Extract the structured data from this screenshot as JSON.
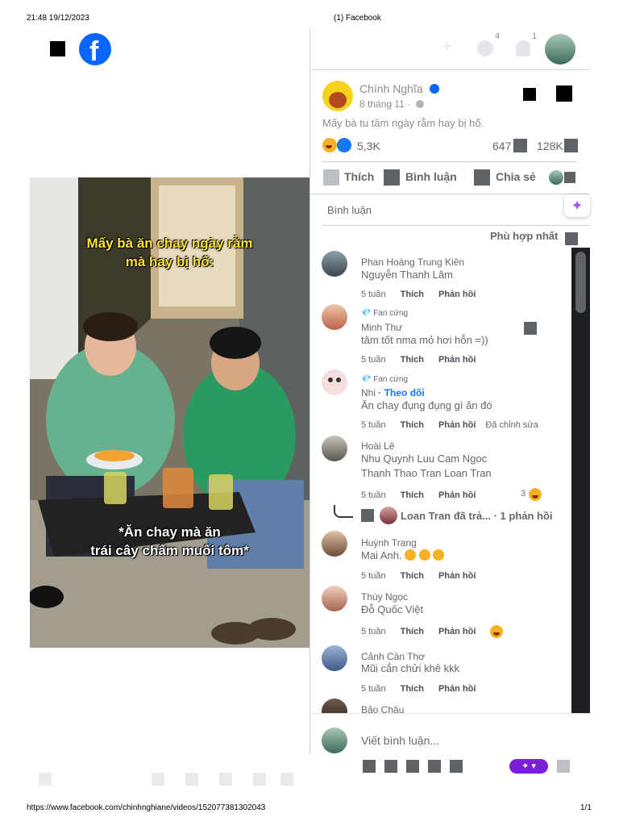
{
  "print": {
    "datetime": "21:48 19/12/2023",
    "tab_title": "(1) Facebook",
    "url": "https://www.facebook.com/chinhnghiane/videos/152077381302043",
    "page": "1/1"
  },
  "topbar": {
    "messenger_count": "4",
    "notif_count": "1"
  },
  "post": {
    "author": "Chính Nghĩa",
    "date": "8 tháng 11 ·",
    "caption": "Mấy bà tu tâm ngày rằm hay bị hố.",
    "reactions": "5,3K",
    "comments_count": "647",
    "shares_count": "128K"
  },
  "actions": {
    "like": "Thích",
    "comment": "Bình luận",
    "share": "Chia sẻ"
  },
  "comments_header": {
    "title": "Bình luận",
    "sort": "Phù hợp nhất"
  },
  "video": {
    "caption_top_line1": "Mấy bà ăn chay ngày rằm",
    "caption_top_line2": "mà hay bị hố:",
    "caption_bottom_line1": "*Ăn chay mà ăn",
    "caption_bottom_line2": "trái cây chấm muối tôm*"
  },
  "comments": [
    {
      "name": "Phan Hoàng Trung Kiên",
      "text": "Nguyễn Thanh Lâm",
      "time": "5 tuần",
      "like": "Thích",
      "reply": "Phản hồi"
    },
    {
      "badge": "Fan cứng",
      "name": "Minh Thư",
      "text": "tâm tốt nma mỏ hơi hỗn =))",
      "time": "5 tuần",
      "like": "Thích",
      "reply": "Phản hồi"
    },
    {
      "badge": "Fan cứng",
      "name": "Nhi",
      "follow": "· Theo dõi",
      "text": "Ăn chay đụng đụng gì ăn đó",
      "time": "5 tuần",
      "like": "Thích",
      "reply": "Phản hồi",
      "edited": "Đã chỉnh sửa"
    },
    {
      "name": "Hoài Lê",
      "text": "Nhu Quynh Luu Cam Ngoc",
      "text2": "Thanh Thao Tran Loan Tran",
      "time": "5 tuần",
      "like": "Thích",
      "reply": "Phản hồi",
      "react_count": "3"
    },
    {
      "name": "Huỳnh Trang",
      "text": "Mai Anh.",
      "time": "5 tuần",
      "like": "Thích",
      "reply": "Phản hồi"
    },
    {
      "name": "Thùy Ngọc",
      "text": "Đỗ Quốc Việt",
      "time": "5 tuần",
      "like": "Thích",
      "reply": "Phản hồi"
    },
    {
      "name": "Cảnh Cần Thơ",
      "text": "Mũi cắn chửi khê kkk",
      "time": "5 tuần",
      "like": "Thích",
      "reply": "Phản hồi"
    },
    {
      "name": "Bảo Châu"
    }
  ],
  "reply_thread": {
    "text": "Loan Tran đã trả...",
    "count": "· 1 phản hồi"
  },
  "composer": {
    "placeholder": "Viết bình luận..."
  },
  "colors": {
    "accent": "#0866ff",
    "scroll_bg": "#1c1e21",
    "ai_button": "#7a1fd6"
  }
}
